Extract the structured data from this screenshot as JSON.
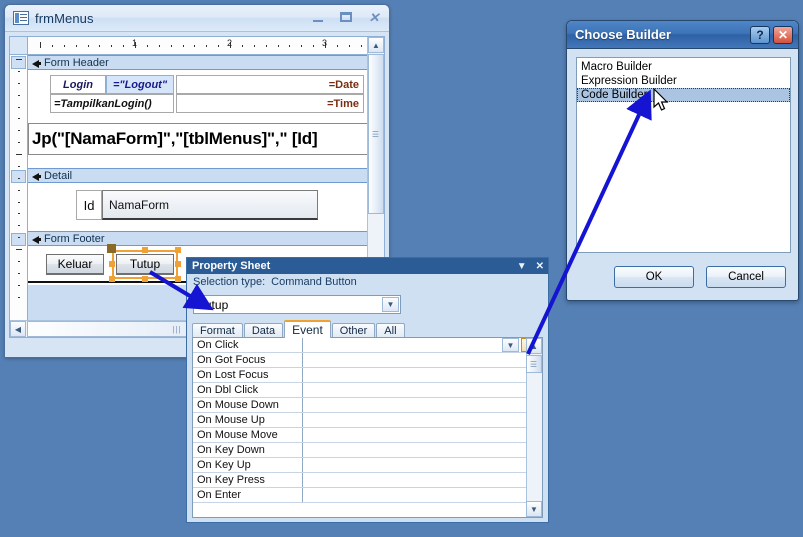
{
  "desktop": {
    "background": "#5580b5"
  },
  "form_window": {
    "title": "frmMenus",
    "icon": "form-design-icon",
    "min_label": "Minimize",
    "max_label": "Restore",
    "close_label": "Close",
    "ruler": {
      "numbers": [
        "1",
        "2",
        "3"
      ]
    },
    "sections": [
      {
        "name": "Form Header",
        "label": "Form Header"
      },
      {
        "name": "Detail",
        "label": "Detail"
      },
      {
        "name": "Form Footer",
        "label": "Form Footer"
      }
    ],
    "header_controls": {
      "login_label": "Login",
      "logout_expr": "=\"Logout\"",
      "tampilkan_expr": "=TampilkanLogin()",
      "date_expr": "=Date",
      "time_expr": "=Time",
      "big_expr": "Jp(\"[NamaForm]\",\"[tblMenus]\",\" [Id]"
    },
    "detail_controls": {
      "id_label": "Id",
      "namaform_field": "NamaForm"
    },
    "footer_controls": {
      "keluar_button": "Keluar",
      "tutup_button": "Tutup"
    }
  },
  "property_sheet": {
    "title": "Property Sheet",
    "collapse_label": "▼",
    "close_label": "✕",
    "selection_type_label": "Selection type:",
    "selection_type_value": "Command Button",
    "object_combo_value": "Tutup",
    "tabs": [
      {
        "label": "Format",
        "active": false
      },
      {
        "label": "Data",
        "active": false
      },
      {
        "label": "Event",
        "active": true
      },
      {
        "label": "Other",
        "active": false
      },
      {
        "label": "All",
        "active": false
      }
    ],
    "active_tab": "Event",
    "accent_color": "#f0a135",
    "title_color": "#2c5c96",
    "rows": [
      {
        "name": "On Click",
        "value": "",
        "has_dropdown": true,
        "has_builder": true
      },
      {
        "name": "On Got Focus",
        "value": "",
        "has_dropdown": false,
        "has_builder": false
      },
      {
        "name": "On Lost Focus",
        "value": "",
        "has_dropdown": false,
        "has_builder": false
      },
      {
        "name": "On Dbl Click",
        "value": "",
        "has_dropdown": false,
        "has_builder": false
      },
      {
        "name": "On Mouse Down",
        "value": "",
        "has_dropdown": false,
        "has_builder": false
      },
      {
        "name": "On Mouse Up",
        "value": "",
        "has_dropdown": false,
        "has_builder": false
      },
      {
        "name": "On Mouse Move",
        "value": "",
        "has_dropdown": false,
        "has_builder": false
      },
      {
        "name": "On Key Down",
        "value": "",
        "has_dropdown": false,
        "has_builder": false
      },
      {
        "name": "On Key Up",
        "value": "",
        "has_dropdown": false,
        "has_builder": false
      },
      {
        "name": "On Key Press",
        "value": "",
        "has_dropdown": false,
        "has_builder": false
      },
      {
        "name": "On Enter",
        "value": "",
        "has_dropdown": false,
        "has_builder": false
      }
    ],
    "builder_button_label": "..."
  },
  "choose_builder": {
    "title": "Choose Builder",
    "help_label": "?",
    "close_label": "✕",
    "items": [
      {
        "label": "Macro Builder",
        "selected": false
      },
      {
        "label": "Expression Builder",
        "selected": false
      },
      {
        "label": "Code Builder",
        "selected": true
      }
    ],
    "ok_label": "OK",
    "cancel_label": "Cancel"
  },
  "annotations": {
    "arrow_color": "#1414d2",
    "arrow_1_desc": "arrow from Tutup button to Property Sheet",
    "arrow_2_desc": "arrow from builder ellipsis button to Code Builder item"
  }
}
